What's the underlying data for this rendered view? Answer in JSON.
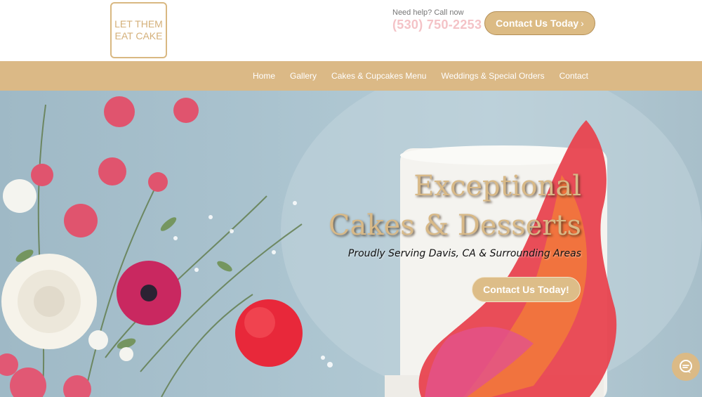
{
  "header": {
    "logo_line1": "LET THEM",
    "logo_line2": "EAT CAKE",
    "help_text": "Need help? Call now",
    "phone": "(530) 750-2253",
    "cta_label": "Contact Us Today"
  },
  "nav": {
    "items": [
      {
        "label": "Home"
      },
      {
        "label": "Gallery"
      },
      {
        "label": "Cakes & Cupcakes Menu"
      },
      {
        "label": "Weddings & Special Orders"
      },
      {
        "label": "Contact"
      }
    ]
  },
  "hero": {
    "title_line1": "Exceptional",
    "title_line2": "Cakes & Desserts",
    "subtitle": "Proudly Serving Davis, CA  &  Surrounding Areas",
    "cta_label": "Contact Us Today!"
  },
  "chat": {
    "icon": "chat-icon"
  },
  "colors": {
    "accent_gold": "#dbb986",
    "phone_pink": "#f4c3c7"
  }
}
